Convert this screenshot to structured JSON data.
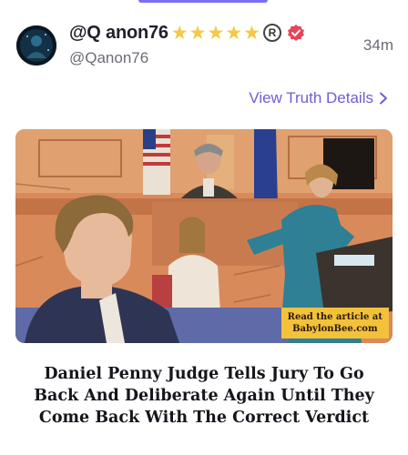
{
  "post": {
    "display_name": "@Q anon76",
    "handle": "@Qanon76",
    "time_ago": "34m",
    "star_count": 5,
    "registered_mark": "R"
  },
  "link": {
    "view_details": "View Truth Details"
  },
  "article": {
    "promo_line1": "Read the article at",
    "promo_line2": "BabylonBee.com",
    "headline_line1": "Daniel Penny Judge Tells Jury To Go",
    "headline_line2": "Back And Deliberate Again Until They",
    "headline_line3": "Come Back With The Correct Verdict"
  },
  "colors": {
    "accent": "#6d5fd4",
    "star": "#f6c843",
    "verified_badge": "#e5455a",
    "promo_bg": "#f3c23a"
  },
  "icons": [
    "star-icon",
    "registered-icon",
    "verified-badge-icon",
    "chevron-right-icon"
  ]
}
